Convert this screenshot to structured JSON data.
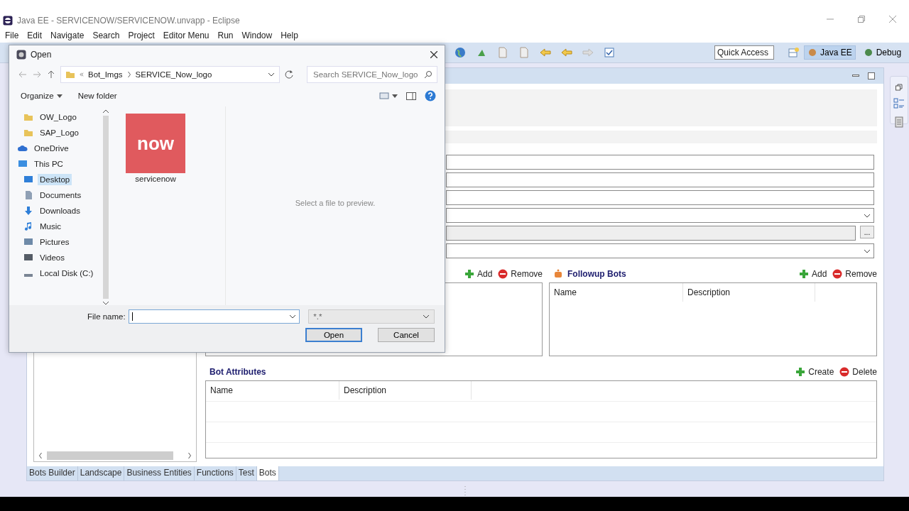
{
  "window": {
    "title": "Java EE - SERVICENOW/SERVICENOW.unvapp - Eclipse"
  },
  "menu": [
    "File",
    "Edit",
    "Navigate",
    "Search",
    "Project",
    "Editor Menu",
    "Run",
    "Window",
    "Help"
  ],
  "toolbar": {
    "quick_access": {
      "placeholder": "Quick Access"
    },
    "perspectives": [
      {
        "label": "Java EE",
        "selected": true
      },
      {
        "label": "Debug",
        "selected": false
      }
    ]
  },
  "editor": {
    "fields": [
      {
        "kind": "text"
      },
      {
        "kind": "text"
      },
      {
        "kind": "text"
      },
      {
        "kind": "combo"
      },
      {
        "kind": "browse",
        "button": "..."
      },
      {
        "kind": "combo"
      }
    ],
    "event_actions": [
      {
        "label": "Add",
        "kind": "add"
      },
      {
        "label": "Remove",
        "kind": "remove"
      }
    ],
    "followup_bots": {
      "title": "Followup Bots",
      "actions": [
        {
          "label": "Add",
          "kind": "add"
        },
        {
          "label": "Remove",
          "kind": "remove"
        }
      ],
      "columns": [
        "Name",
        "Description"
      ]
    },
    "bot_attributes": {
      "title": "Bot Attributes",
      "actions": [
        {
          "label": "Create",
          "kind": "add"
        },
        {
          "label": "Delete",
          "kind": "remove"
        }
      ],
      "columns": [
        "Name",
        "Description"
      ]
    }
  },
  "bottom_tabs": [
    {
      "label": "Bots Builder",
      "selected": false
    },
    {
      "label": "Landscape",
      "selected": false
    },
    {
      "label": "Business Entities",
      "selected": false
    },
    {
      "label": "Functions",
      "selected": false
    },
    {
      "label": "Test",
      "selected": false
    },
    {
      "label": "Bots",
      "selected": true
    }
  ],
  "dialog": {
    "title": "Open",
    "breadcrumb": [
      "Bot_Imgs",
      "SERVICE_Now_logo"
    ],
    "search": {
      "placeholder": "Search SERVICE_Now_logo"
    },
    "toolbar": [
      "Organize",
      "New folder"
    ],
    "nav": [
      {
        "label": "OW_Logo",
        "kind": "folder",
        "selected": false
      },
      {
        "label": "SAP_Logo",
        "kind": "folder",
        "selected": false
      },
      {
        "label": "OneDrive",
        "kind": "cloud",
        "selected": false
      },
      {
        "label": "This PC",
        "kind": "pc",
        "selected": false
      },
      {
        "label": "Desktop",
        "kind": "desktop",
        "selected": true
      },
      {
        "label": "Documents",
        "kind": "documents",
        "selected": false
      },
      {
        "label": "Downloads",
        "kind": "downloads",
        "selected": false
      },
      {
        "label": "Music",
        "kind": "music",
        "selected": false
      },
      {
        "label": "Pictures",
        "kind": "pictures",
        "selected": false
      },
      {
        "label": "Videos",
        "kind": "videos",
        "selected": false
      },
      {
        "label": "Local Disk (C:)",
        "kind": "disk",
        "selected": false
      }
    ],
    "files": [
      {
        "name": "servicenow",
        "logo": "now"
      }
    ],
    "preview": "Select a file to preview.",
    "file_name_label": "File name:",
    "filter": "*.*",
    "buttons": [
      "Open",
      "Cancel"
    ]
  }
}
